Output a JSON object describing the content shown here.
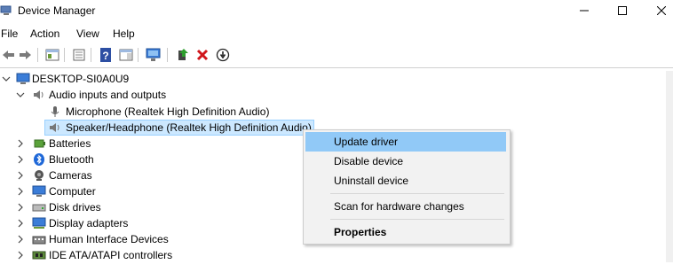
{
  "window": {
    "title": "Device Manager"
  },
  "menu": [
    "File",
    "Action",
    "View",
    "Help"
  ],
  "tree": {
    "root": "DESKTOP-SI0A0U9",
    "audio_category": "Audio inputs and outputs",
    "audio_children": [
      "Microphone (Realtek High Definition Audio)",
      "Speaker/Headphone (Realtek High Definition Audio)"
    ],
    "categories": [
      "Batteries",
      "Bluetooth",
      "Cameras",
      "Computer",
      "Disk drives",
      "Display adapters",
      "Human Interface Devices",
      "IDE ATA/ATAPI controllers"
    ]
  },
  "context_menu": {
    "items": [
      "Update driver",
      "Disable device",
      "Uninstall device",
      "Scan for hardware changes",
      "Properties"
    ]
  }
}
